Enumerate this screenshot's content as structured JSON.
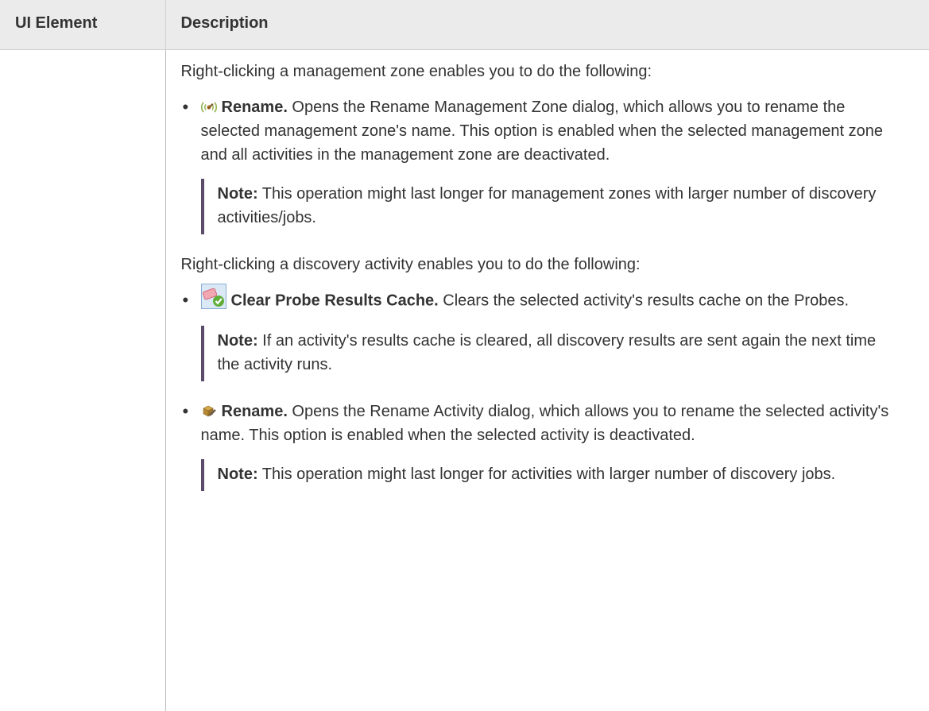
{
  "table": {
    "header": {
      "ui_element": "UI Element",
      "description": "Description"
    }
  },
  "desc": {
    "intro_zone": "Right-clicking a management zone enables you to do the following:",
    "zone_items": [
      {
        "icon": "management-zone-rename-icon",
        "title": "Rename.",
        "text": " Opens the Rename Management Zone dialog, which allows you to rename the selected management zone's name. This option is enabled when the selected management zone and all activities in the management zone are deactivated.",
        "note_label": "Note:",
        "note_text": " This operation might last longer for management zones with larger number of discovery activities/jobs."
      }
    ],
    "intro_activity": "Right-clicking a discovery activity enables you to do the following:",
    "activity_items": [
      {
        "icon": "clear-cache-icon",
        "title": "Clear Probe Results Cache.",
        "text": " Clears the selected activity's results cache on the Probes.",
        "note_label": "Note:",
        "note_text": " If an activity's results cache is cleared, all discovery results are sent again the next time the activity runs."
      },
      {
        "icon": "activity-rename-icon",
        "title": "Rename.",
        "text": " Opens the Rename Activity dialog, which allows you to rename the selected activity's name. This option is enabled when the selected activity is deactivated.",
        "note_label": "Note:",
        "note_text": " This operation might last longer for activities with larger number of discovery jobs."
      }
    ]
  },
  "colors": {
    "header_bg": "#ebebeb",
    "text": "#333333",
    "note_bar": "#5b4b6b"
  }
}
